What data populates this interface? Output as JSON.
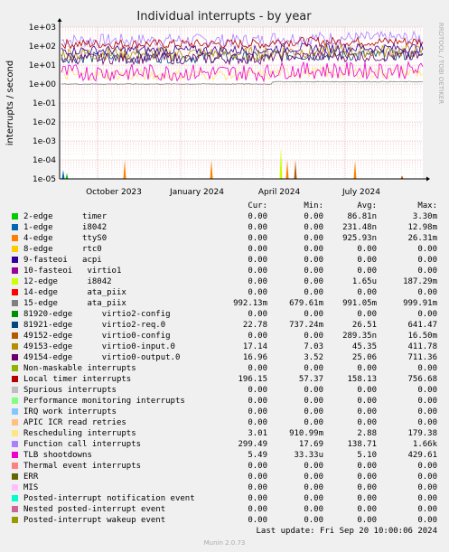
{
  "chart_data": {
    "type": "line",
    "title": "Individual interrupts - by year",
    "ylabel": "interrupts / second",
    "side_label": "RRDTOOL / TOBI OETIKER",
    "scale": "log",
    "ylim": [
      1e-05,
      1000
    ],
    "grid": true,
    "y_ticks": [
      "1e+03",
      "1e+02",
      "1e+01",
      "1e+00",
      "1e-01",
      "1e-02",
      "1e-03",
      "1e-04",
      "1e-05"
    ],
    "x_ticks": [
      "October 2023",
      "January 2024",
      "April 2024",
      "July 2024"
    ],
    "columns": [
      "Cur:",
      "Min:",
      "Avg:",
      "Max:"
    ],
    "series": [
      {
        "name": "2-edge      timer",
        "color": "#00cc00",
        "cur": "0.00",
        "min": "0.00",
        "avg": "86.81n",
        "max": "3.30m"
      },
      {
        "name": "1-edge      i8042",
        "color": "#0066b3",
        "cur": "0.00",
        "min": "0.00",
        "avg": "231.48n",
        "max": "12.98m"
      },
      {
        "name": "4-edge      ttyS0",
        "color": "#ff8000",
        "cur": "0.00",
        "min": "0.00",
        "avg": "925.93n",
        "max": "26.31m"
      },
      {
        "name": "8-edge      rtc0",
        "color": "#ffcc00",
        "cur": "0.00",
        "min": "0.00",
        "avg": "0.00",
        "max": "0.00"
      },
      {
        "name": "9-fasteoi   acpi",
        "color": "#330099",
        "cur": "0.00",
        "min": "0.00",
        "avg": "0.00",
        "max": "0.00"
      },
      {
        "name": "10-fasteoi   virtio1",
        "color": "#990099",
        "cur": "0.00",
        "min": "0.00",
        "avg": "0.00",
        "max": "0.00"
      },
      {
        "name": "12-edge      i8042",
        "color": "#ccff00",
        "cur": "0.00",
        "min": "0.00",
        "avg": "1.65u",
        "max": "187.29m"
      },
      {
        "name": "14-edge      ata_piix",
        "color": "#ff0000",
        "cur": "0.00",
        "min": "0.00",
        "avg": "0.00",
        "max": "0.00"
      },
      {
        "name": "15-edge      ata_piix",
        "color": "#808080",
        "cur": "992.13m",
        "min": "679.61m",
        "avg": "991.05m",
        "max": "999.91m"
      },
      {
        "name": "81920-edge      virtio2-config",
        "color": "#008f00",
        "cur": "0.00",
        "min": "0.00",
        "avg": "0.00",
        "max": "0.00"
      },
      {
        "name": "81921-edge      virtio2-req.0",
        "color": "#00487d",
        "cur": "22.78",
        "min": "737.24m",
        "avg": "26.51",
        "max": "641.47"
      },
      {
        "name": "49152-edge      virtio0-config",
        "color": "#b35a00",
        "cur": "0.00",
        "min": "0.00",
        "avg": "289.35n",
        "max": "16.50m"
      },
      {
        "name": "49153-edge      virtio0-input.0",
        "color": "#b38f00",
        "cur": "17.14",
        "min": "7.03",
        "avg": "45.35",
        "max": "411.78"
      },
      {
        "name": "49154-edge      virtio0-output.0",
        "color": "#6b006b",
        "cur": "16.96",
        "min": "3.52",
        "avg": "25.06",
        "max": "711.36"
      },
      {
        "name": "Non-maskable interrupts",
        "color": "#8fb300",
        "cur": "0.00",
        "min": "0.00",
        "avg": "0.00",
        "max": "0.00"
      },
      {
        "name": "Local timer interrupts",
        "color": "#b30000",
        "cur": "196.15",
        "min": "57.37",
        "avg": "158.13",
        "max": "756.68"
      },
      {
        "name": "Spurious interrupts",
        "color": "#bebebe",
        "cur": "0.00",
        "min": "0.00",
        "avg": "0.00",
        "max": "0.00"
      },
      {
        "name": "Performance monitoring interrupts",
        "color": "#80ff80",
        "cur": "0.00",
        "min": "0.00",
        "avg": "0.00",
        "max": "0.00"
      },
      {
        "name": "IRQ work interrupts",
        "color": "#80c9ff",
        "cur": "0.00",
        "min": "0.00",
        "avg": "0.00",
        "max": "0.00"
      },
      {
        "name": "APIC ICR read retries",
        "color": "#ffc080",
        "cur": "0.00",
        "min": "0.00",
        "avg": "0.00",
        "max": "0.00"
      },
      {
        "name": "Rescheduling interrupts",
        "color": "#ffe680",
        "cur": "3.01",
        "min": "910.99m",
        "avg": "2.88",
        "max": "179.38"
      },
      {
        "name": "Function call interrupts",
        "color": "#aa80ff",
        "cur": "299.49",
        "min": "17.69",
        "avg": "138.71",
        "max": "1.66k"
      },
      {
        "name": "TLB shootdowns",
        "color": "#ee00cc",
        "cur": "5.49",
        "min": "33.33u",
        "avg": "5.10",
        "max": "429.61"
      },
      {
        "name": "Thermal event interrupts",
        "color": "#ff8080",
        "cur": "0.00",
        "min": "0.00",
        "avg": "0.00",
        "max": "0.00"
      },
      {
        "name": "ERR",
        "color": "#666600",
        "cur": "0.00",
        "min": "0.00",
        "avg": "0.00",
        "max": "0.00"
      },
      {
        "name": "MIS",
        "color": "#ffbfff",
        "cur": "0.00",
        "min": "0.00",
        "avg": "0.00",
        "max": "0.00"
      },
      {
        "name": "Posted-interrupt notification event",
        "color": "#00ffcc",
        "cur": "0.00",
        "min": "0.00",
        "avg": "0.00",
        "max": "0.00"
      },
      {
        "name": "Nested posted-interrupt event",
        "color": "#cc6699",
        "cur": "0.00",
        "min": "0.00",
        "avg": "0.00",
        "max": "0.00"
      },
      {
        "name": "Posted-interrupt wakeup event",
        "color": "#999900",
        "cur": "0.00",
        "min": "0.00",
        "avg": "0.00",
        "max": "0.00"
      }
    ]
  },
  "footer": {
    "last_update": "Last update: Fri Sep 20 10:00:06 2024",
    "munin": "Munin 2.0.73"
  }
}
